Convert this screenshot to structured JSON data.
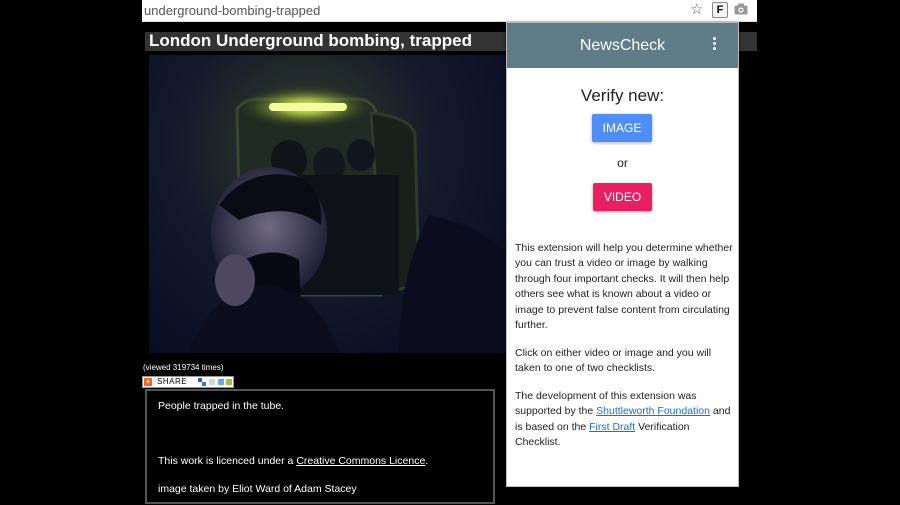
{
  "browser": {
    "address_text": "underground-bombing-trapped",
    "extension_icon_letter": "F"
  },
  "page": {
    "title": "London Underground bombing, trapped",
    "view_count": "(viewed 319734 times)",
    "share_label": "SHARE",
    "description": {
      "caption": "People trapped in the tube.",
      "licence_prefix": "This work is licenced under a ",
      "licence_link": "Creative Commons Licence",
      "licence_suffix": ".",
      "credit": "image taken by Eliot Ward of Adam Stacey"
    }
  },
  "popup": {
    "title": "NewsCheck",
    "verify_label": "Verify new:",
    "image_button": "IMAGE",
    "or_label": "or",
    "video_button": "VIDEO",
    "para1": "This extension will help you determine whether you can trust a video or image by walking through four important checks. It will then help others see what is known about a video or image to prevent false content from circulating further.",
    "para2": "Click on either video or image and you will taken to one of two checklists.",
    "para3_prefix": "The development of this extension was supported by the ",
    "para3_link1": "Shuttleworth Foundation",
    "para3_middle": " and is based on the ",
    "para3_link2": "First Draft",
    "para3_suffix": " Verification Checklist.",
    "colors": {
      "header": "#5f7b86",
      "image_button": "#4f8ef7",
      "video_button": "#e91e63",
      "link": "#1a6fd1"
    }
  }
}
